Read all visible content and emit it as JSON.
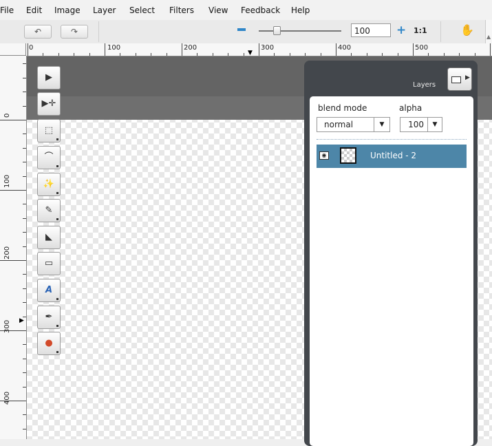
{
  "menu": [
    "File",
    "Edit",
    "Image",
    "Layer",
    "Select",
    "Filters",
    "View",
    "Feedback",
    "Help"
  ],
  "toolbar": {
    "undo_icon": "undo-icon",
    "redo_icon": "redo-icon",
    "zoom_value": "100",
    "zoom_ratio": "1:1",
    "accent": "#2f86c8"
  },
  "ruler": {
    "h_labels": [
      "0",
      "100",
      "200",
      "300",
      "400",
      "500"
    ],
    "v_labels": [
      "0",
      "100",
      "200",
      "300",
      "400"
    ]
  },
  "tools": [
    "select-arrow-icon",
    "move-icon",
    "rect-select-icon",
    "lasso-icon",
    "magic-wand-icon",
    "brush-icon",
    "fill-bucket-icon",
    "gradient-icon",
    "text-icon",
    "eyedropper-icon",
    "color-palette-icon"
  ],
  "layers_panel": {
    "title": "Layers",
    "blend_label": "blend mode",
    "alpha_label": "alpha",
    "blend_value": "normal",
    "alpha_value": "100",
    "selected_color": "#4d86a8",
    "layers": [
      {
        "name": "Untitled - 2"
      }
    ]
  }
}
